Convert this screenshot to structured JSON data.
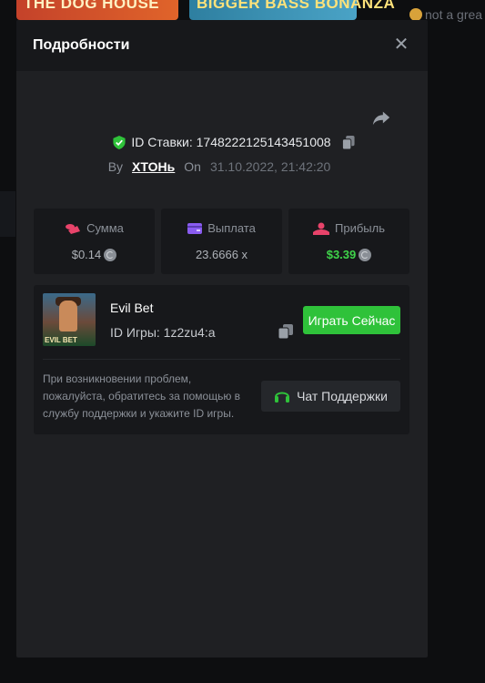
{
  "background": {
    "banner_left": "THE DOG HOUSE",
    "banner_right": "BIGGER BASS BONANZA",
    "right_text": "not a grea"
  },
  "modal": {
    "title": "Подробности",
    "bet_id": "ID Ставки: 1748222125143451008",
    "by_label": "By",
    "user": "XTOHь",
    "on_label": "On",
    "date": "31.10.2022, 21:42:20"
  },
  "stats": [
    {
      "label": "Сумма",
      "value": "$0.14",
      "icon": "coins-icon",
      "color": "#e8436a"
    },
    {
      "label": "Выплата",
      "value": "23.6666 x",
      "icon": "wallet-icon",
      "color": "#8a5cf0"
    },
    {
      "label": "Прибыль",
      "value": "$3.39",
      "icon": "profit-icon",
      "color": "#e8436a"
    }
  ],
  "game": {
    "name": "Evil Bet",
    "id": "ID Игры: 1z2zu4:a",
    "thumb_text": "EVIL BET",
    "play_label": "Играть Сейчас",
    "help_text": "При возникновении проблем, пожалуйста, обратитесь за помощью в службу поддержки и укажите ID игры.",
    "support_label": "Чат Поддержки"
  },
  "colors": {
    "accent_green": "#2fc23a",
    "profit_green": "#3fd44a",
    "modal_bg": "#1f2023",
    "card_bg": "#17181b"
  }
}
